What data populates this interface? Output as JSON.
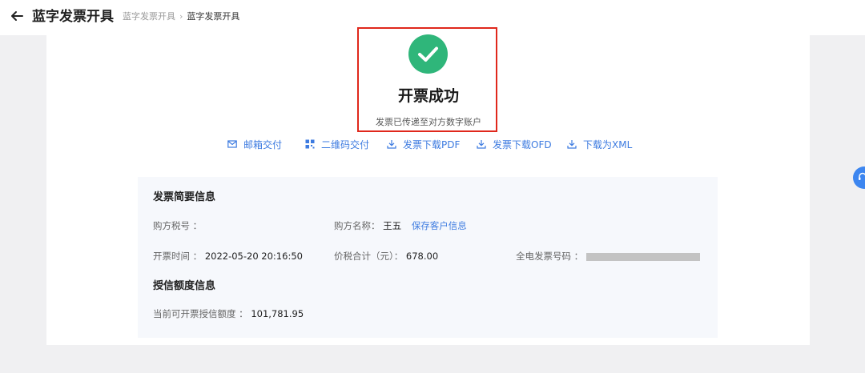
{
  "header": {
    "title": "蓝字发票开具",
    "breadcrumb": [
      "蓝字发票开具",
      "蓝字发票开具"
    ]
  },
  "result": {
    "title": "开票成功",
    "subtitle": "发票已传递至对方数字账户"
  },
  "actions": [
    {
      "label": "邮箱交付",
      "icon": "mail-icon"
    },
    {
      "label": "二维码交付",
      "icon": "qrcode-icon"
    },
    {
      "label": "发票下载PDF",
      "icon": "download-icon"
    },
    {
      "label": "发票下载OFD",
      "icon": "download-icon"
    },
    {
      "label": "下载为XML",
      "icon": "download-icon"
    }
  ],
  "summary": {
    "title": "发票简要信息",
    "buyer_tax_label": "购方税号 ：",
    "buyer_tax_value": "",
    "buyer_name_label": "购方名称：",
    "buyer_name_value": "王五",
    "save_customer_link": "保存客户信息",
    "issue_time_label": "开票时间 ：",
    "issue_time_value": "2022-05-20 20:16:50",
    "total_label": "价税合计（元）：",
    "total_value": "678.00",
    "invoice_no_label": "全电发票号码 ："
  },
  "credit": {
    "title": "授信额度信息",
    "available_label": "当前可开票授信额度 ：",
    "available_value": "101,781.95"
  },
  "colors": {
    "accent": "#3d7be0",
    "success": "#2fb67a",
    "highlight": "#e0281c"
  }
}
